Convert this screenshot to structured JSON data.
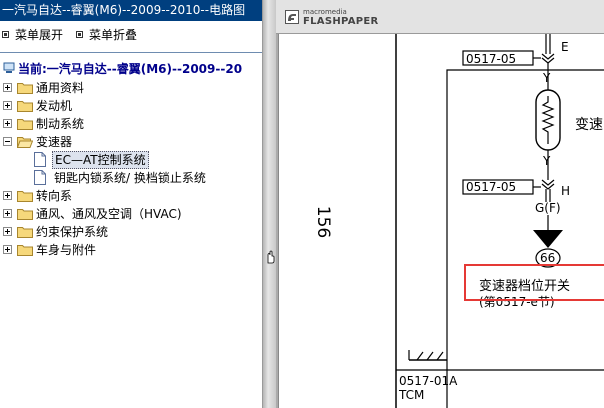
{
  "window": {
    "title": "一汽马自达--睿翼(M6)--2009--2010--电路图"
  },
  "menu": {
    "expand_label": "菜单展开",
    "collapse_label": "菜单折叠"
  },
  "tree": {
    "current_label": "当前:一汽马自达--睿翼(M6)--2009--20",
    "items": [
      {
        "label": "通用资料",
        "expanded": false
      },
      {
        "label": "发动机",
        "expanded": false
      },
      {
        "label": "制动系统",
        "expanded": false
      },
      {
        "label": "变速器",
        "expanded": true,
        "children": [
          {
            "label": "EC—AT控制系统",
            "selected": true
          },
          {
            "label": "钥匙内锁系统/ 换档锁止系统",
            "selected": false
          }
        ]
      },
      {
        "label": "转向系",
        "expanded": false
      },
      {
        "label": "通风、通风及空调（HVAC)",
        "expanded": false
      },
      {
        "label": "约束保护系统",
        "expanded": false
      },
      {
        "label": "车身与附件",
        "expanded": false
      }
    ]
  },
  "viewer": {
    "logo_small": "macromedia",
    "logo_big": "FLASHPAPER",
    "page_number": "156"
  },
  "diagram": {
    "connector_top": "0517-05",
    "connector_bottom": "0517-05",
    "pin_top": "E",
    "pin_y_upper": "Y",
    "pin_y_lower": "Y",
    "pin_bottom": "H",
    "wire_color": "G(F)",
    "ground_number": "66",
    "component_label": "变速",
    "switch_label": "变速器档位开关",
    "page_ref": "(第0517-e节)",
    "tcm_code": "0517-01A",
    "tcm_name": "TCM"
  },
  "colors": {
    "title_bar_bg": "#003f7f",
    "current_text": "#00008b",
    "highlight_border": "#e53935",
    "folder_fill": "#f6d87b"
  }
}
